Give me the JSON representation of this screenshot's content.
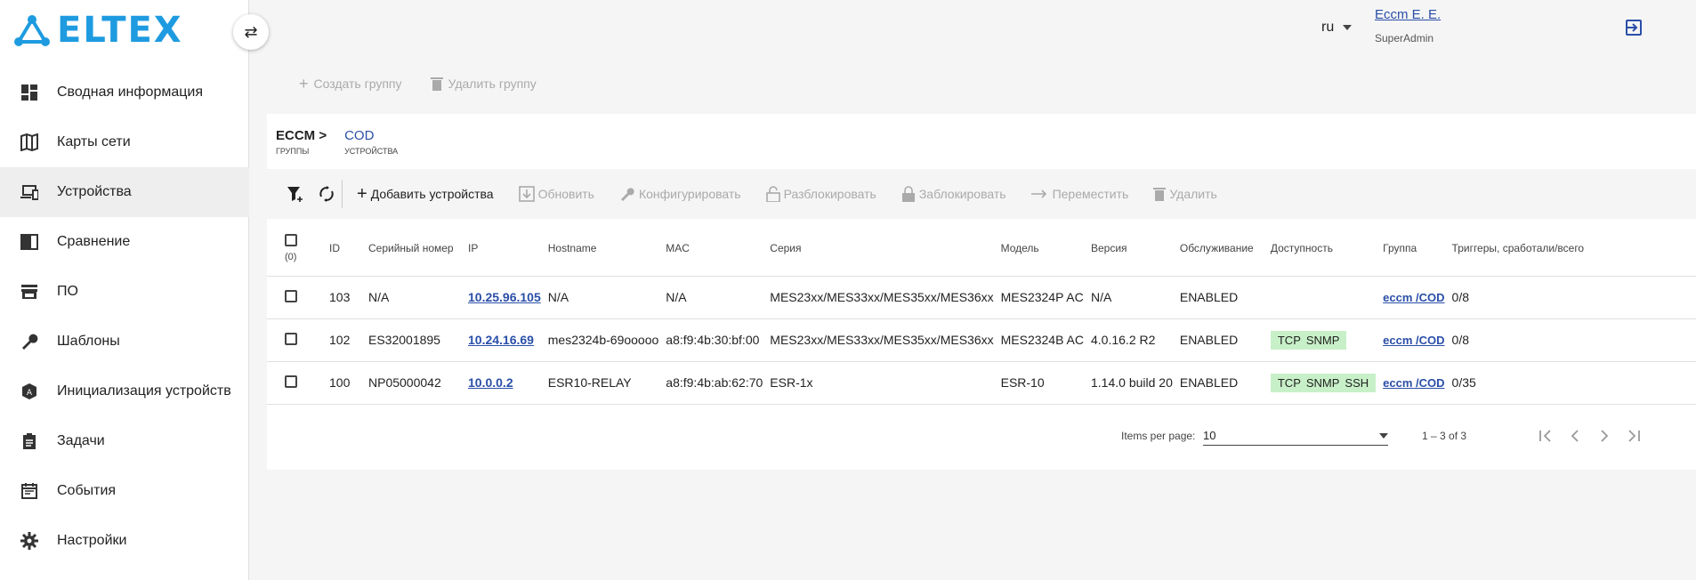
{
  "brand": {
    "logo_text": "ELTEX",
    "color": "#1e9be0"
  },
  "sidebar": {
    "items": [
      {
        "label": "Сводная информация",
        "icon": "dashboard-icon"
      },
      {
        "label": "Карты сети",
        "icon": "map-icon"
      },
      {
        "label": "Устройства",
        "icon": "devices-icon",
        "active": true
      },
      {
        "label": "Сравнение",
        "icon": "compare-icon"
      },
      {
        "label": "ПО",
        "icon": "store-icon"
      },
      {
        "label": "Шаблоны",
        "icon": "wrench-icon"
      },
      {
        "label": "Инициализация устройств",
        "icon": "init-icon"
      },
      {
        "label": "Задачи",
        "icon": "clipboard-icon"
      },
      {
        "label": "События",
        "icon": "calendar-icon"
      },
      {
        "label": "Настройки",
        "icon": "gear-icon"
      }
    ]
  },
  "header": {
    "lang": "ru",
    "user_name": "Eccm E. E.",
    "user_role": "SuperAdmin"
  },
  "group_toolbar": {
    "create": "Создать группу",
    "delete": "Удалить группу"
  },
  "breadcrumb": {
    "root": "ECCM >",
    "root_sub": "Группы",
    "current": "COD",
    "current_sub": "Устройства"
  },
  "actions": {
    "add": "Добавить устройства",
    "update": "Обновить",
    "configure": "Конфигурировать",
    "unlock": "Разблокировать",
    "lock": "Заблокировать",
    "move": "Переместить",
    "delete": "Удалить"
  },
  "table": {
    "select_count": "(0)",
    "headers": {
      "id": "ID",
      "serial": "Серийный номер",
      "ip": "IP",
      "hostname": "Hostname",
      "mac": "MAC",
      "series": "Серия",
      "model": "Модель",
      "version": "Версия",
      "service": "Обслуживание",
      "availability": "Доступность",
      "group": "Группа",
      "triggers": "Триггеры, сработали/всего"
    },
    "rows": [
      {
        "id": "103",
        "serial": "N/A",
        "ip": "10.25.96.105",
        "hostname": "N/A",
        "mac": "N/A",
        "series": "MES23xx/MES33xx/MES35xx/MES36xx",
        "model": "MES2324P AC",
        "version": "N/A",
        "service": "ENABLED",
        "avail": [],
        "group": "eccm /COD",
        "triggers": "0/8"
      },
      {
        "id": "102",
        "serial": "ES32001895",
        "ip": "10.24.16.69",
        "hostname": "mes2324b-69ooooo",
        "mac": "a8:f9:4b:30:bf:00",
        "series": "MES23xx/MES33xx/MES35xx/MES36xx",
        "model": "MES2324B AC",
        "version": "4.0.16.2 R2",
        "service": "ENABLED",
        "avail": [
          "TCP",
          "SNMP"
        ],
        "group": "eccm /COD",
        "triggers": "0/8"
      },
      {
        "id": "100",
        "serial": "NP05000042",
        "ip": "10.0.0.2",
        "hostname": "ESR10-RELAY",
        "mac": "a8:f9:4b:ab:62:70",
        "series": "ESR-1x",
        "model": "ESR-10",
        "version": "1.14.0 build 20",
        "service": "ENABLED",
        "avail": [
          "TCP",
          "SNMP",
          "SSH"
        ],
        "group": "eccm /COD",
        "triggers": "0/35"
      }
    ]
  },
  "pager": {
    "label": "Items per page:",
    "value": "10",
    "range": "1 – 3 of 3"
  }
}
